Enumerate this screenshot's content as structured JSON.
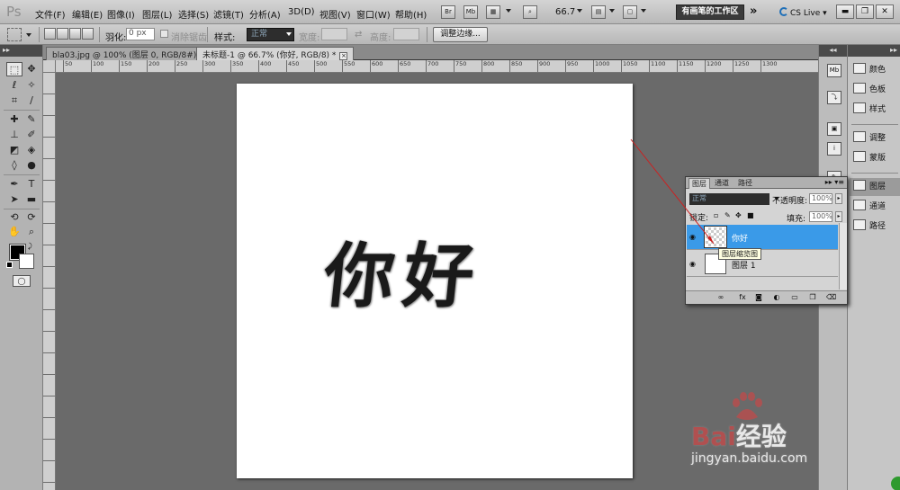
{
  "app": {
    "logo": "Ps"
  },
  "menu": [
    "文件(F)",
    "编辑(E)",
    "图像(I)",
    "图层(L)",
    "选择(S)",
    "滤镜(T)",
    "分析(A)",
    "3D(D)",
    "视图(V)",
    "窗口(W)",
    "帮助(H)"
  ],
  "menubar_tools": {
    "bridge": "Br",
    "mini_bridge": "Mb",
    "zoom": "66.7",
    "workspace": "有画笔的工作区",
    "more": "»",
    "cslive": "CS Live"
  },
  "options": {
    "feather_label": "羽化:",
    "feather_value": "0 px",
    "antialias_label": "消除锯齿",
    "style_label": "样式:",
    "style_value": "正常",
    "width_label": "宽度:",
    "height_label": "高度:",
    "refine_edge": "调整边缘..."
  },
  "doc_tabs": [
    {
      "title": "bla03.jpg @ 100% (图层 0, RGB/8#) *"
    },
    {
      "title": "未标题-1 @ 66.7% (你好, RGB/8) *"
    }
  ],
  "ruler": [
    "50",
    "100",
    "150",
    "200",
    "250",
    "300",
    "350",
    "400",
    "450",
    "500",
    "550",
    "600",
    "650",
    "700",
    "750",
    "800",
    "850",
    "900",
    "950",
    "1000",
    "1050",
    "1100",
    "1150",
    "1200",
    "1250",
    "1300"
  ],
  "canvas": {
    "text": "你好"
  },
  "right_dock": {
    "items": [
      "颜色",
      "色板",
      "样式",
      "调整",
      "蒙版",
      "图层",
      "通道",
      "路径"
    ]
  },
  "layers_panel": {
    "tabs": [
      "图层",
      "通道",
      "路径"
    ],
    "blend_mode": "正常",
    "opacity_label": "不透明度:",
    "opacity_value": "100%",
    "lock_label": "锁定:",
    "fill_label": "填充:",
    "fill_value": "100%",
    "layers": [
      {
        "name": "你好",
        "selected": true
      },
      {
        "name": "图层 1",
        "selected": false
      }
    ],
    "tooltip": "图层缩览图"
  },
  "watermark": {
    "brand_a": "Bai",
    "brand_b": "经验",
    "url": "jingyan.baidu.com"
  }
}
